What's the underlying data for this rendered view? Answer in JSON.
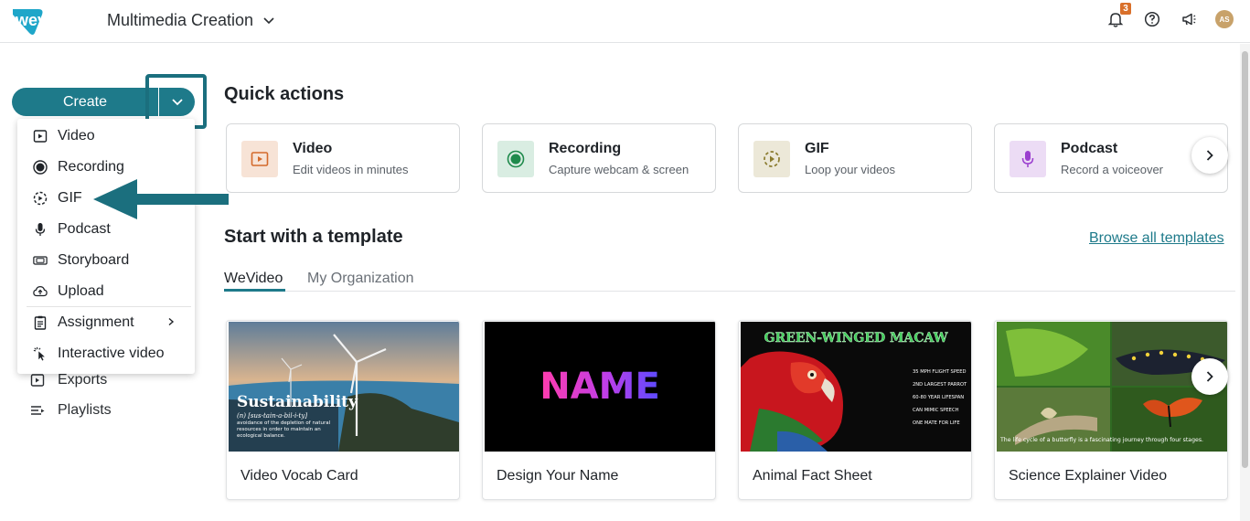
{
  "header": {
    "logo_text": "wevideo",
    "workspace": "Multimedia Creation",
    "notification_count": "3",
    "avatar_initials": "AS"
  },
  "create": {
    "label": "Create"
  },
  "menu": {
    "items": [
      {
        "label": "Video",
        "icon": "video-icon"
      },
      {
        "label": "Recording",
        "icon": "record-icon"
      },
      {
        "label": "GIF",
        "icon": "gif-icon"
      },
      {
        "label": "Podcast",
        "icon": "microphone-icon"
      },
      {
        "label": "Storyboard",
        "icon": "storyboard-icon"
      },
      {
        "label": "Upload",
        "icon": "upload-icon"
      },
      {
        "label": "Assignment",
        "icon": "assignment-icon"
      },
      {
        "label": "Interactive video",
        "icon": "pointer-click-icon"
      }
    ]
  },
  "sidebar": {
    "items": [
      {
        "label": "Exports",
        "icon": "export-icon"
      },
      {
        "label": "Playlists",
        "icon": "playlist-icon"
      }
    ]
  },
  "quick_actions": {
    "title": "Quick actions",
    "cards": [
      {
        "title": "Video",
        "subtitle": "Edit videos in minutes",
        "icon": "video-icon",
        "bg": "#f7e3d6",
        "fg": "#d46a2b"
      },
      {
        "title": "Recording",
        "subtitle": "Capture webcam & screen",
        "icon": "record-icon",
        "bg": "#d9ede2",
        "fg": "#1f8a4c"
      },
      {
        "title": "GIF",
        "subtitle": "Loop your videos",
        "icon": "gif-icon",
        "bg": "#ece8d8",
        "fg": "#8a7b2e"
      },
      {
        "title": "Podcast",
        "subtitle": "Record a voiceover",
        "icon": "microphone-icon",
        "bg": "#ecdcf5",
        "fg": "#9b3fcf"
      }
    ]
  },
  "templates": {
    "title": "Start with a template",
    "browse_link": "Browse all templates",
    "tabs": [
      {
        "label": "WeVideo",
        "active": true
      },
      {
        "label": "My Organization",
        "active": false
      }
    ],
    "cards": [
      {
        "name": "Video Vocab Card",
        "thumb_title": "Sustainability",
        "thumb_sub": "(n) [sus-tain-a-bil-i-ty]",
        "thumb_desc": "avoidance of the depletion of natural resources in order to maintain an ecological balance."
      },
      {
        "name": "Design Your Name",
        "thumb_title": "NAME"
      },
      {
        "name": "Animal Fact Sheet",
        "thumb_title": "GREEN-WINGED MACAW",
        "facts": [
          "35 MPH FLIGHT SPEED",
          "2ND LARGEST PARROT",
          "60-80 YEAR LIFESPAN",
          "CAN MIMIC SPEECH",
          "ONE MATE FOR LIFE"
        ]
      },
      {
        "name": "Science Explainer Video",
        "caption": "The life cycle of a butterfly is a fascinating journey through four stages."
      }
    ]
  },
  "colors": {
    "brand": "#1e7a8a",
    "notification": "#d9702b"
  }
}
